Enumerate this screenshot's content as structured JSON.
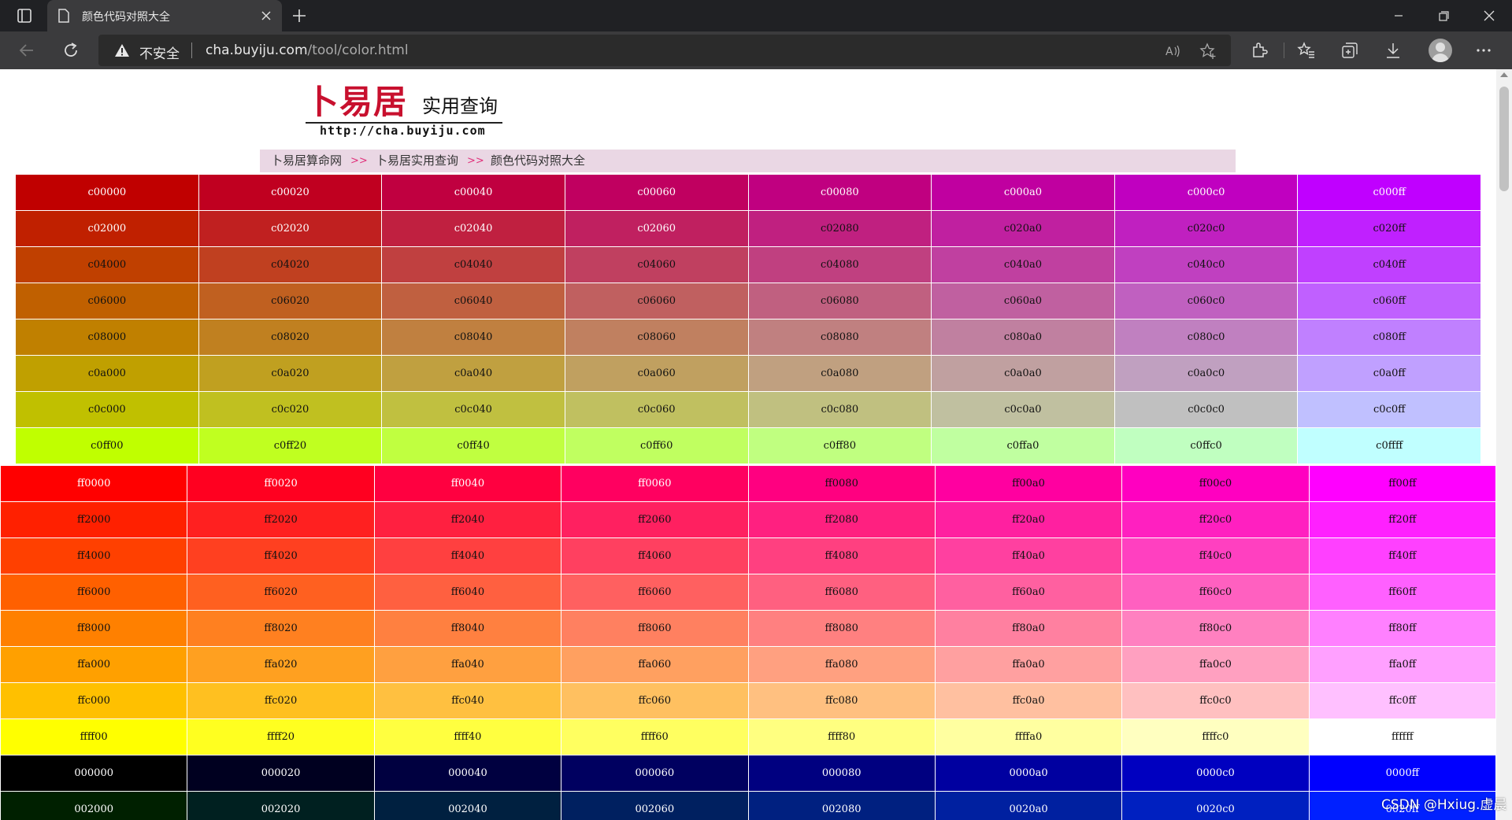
{
  "browser": {
    "tab_title": "颜色代码对照大全",
    "security_label": "不安全",
    "url_host": "cha.buyiju.com",
    "url_path": "/tool/color.html"
  },
  "logo": {
    "brand": "卜易居",
    "subtitle": "实用查询",
    "site": "http://cha.buyiju.com"
  },
  "breadcrumb": {
    "items": [
      "卜易居算命网",
      "卜易居实用查询",
      "颜色代码对照大全"
    ],
    "separator": ">>"
  },
  "table1": {
    "rows": [
      [
        "c00000",
        "c00020",
        "c00040",
        "c00060",
        "c00080",
        "c000a0",
        "c000c0",
        "c000ff"
      ],
      [
        "c02000",
        "c02020",
        "c02040",
        "c02060",
        "c02080",
        "c020a0",
        "c020c0",
        "c020ff"
      ],
      [
        "c04000",
        "c04020",
        "c04040",
        "c04060",
        "c04080",
        "c040a0",
        "c040c0",
        "c040ff"
      ],
      [
        "c06000",
        "c06020",
        "c06040",
        "c06060",
        "c06080",
        "c060a0",
        "c060c0",
        "c060ff"
      ],
      [
        "c08000",
        "c08020",
        "c08040",
        "c08060",
        "c08080",
        "c080a0",
        "c080c0",
        "c080ff"
      ],
      [
        "c0a000",
        "c0a020",
        "c0a040",
        "c0a060",
        "c0a080",
        "c0a0a0",
        "c0a0c0",
        "c0a0ff"
      ],
      [
        "c0c000",
        "c0c020",
        "c0c040",
        "c0c060",
        "c0c080",
        "c0c0a0",
        "c0c0c0",
        "c0c0ff"
      ],
      [
        "c0ff00",
        "c0ff20",
        "c0ff40",
        "c0ff60",
        "c0ff80",
        "c0ffa0",
        "c0ffc0",
        "c0ffff"
      ]
    ]
  },
  "table2": {
    "rows": [
      [
        "ff0000",
        "ff0020",
        "ff0040",
        "ff0060",
        "ff0080",
        "ff00a0",
        "ff00c0",
        "ff00ff"
      ],
      [
        "ff2000",
        "ff2020",
        "ff2040",
        "ff2060",
        "ff2080",
        "ff20a0",
        "ff20c0",
        "ff20ff"
      ],
      [
        "ff4000",
        "ff4020",
        "ff4040",
        "ff4060",
        "ff4080",
        "ff40a0",
        "ff40c0",
        "ff40ff"
      ],
      [
        "ff6000",
        "ff6020",
        "ff6040",
        "ff6060",
        "ff6080",
        "ff60a0",
        "ff60c0",
        "ff60ff"
      ],
      [
        "ff8000",
        "ff8020",
        "ff8040",
        "ff8060",
        "ff8080",
        "ff80a0",
        "ff80c0",
        "ff80ff"
      ],
      [
        "ffa000",
        "ffa020",
        "ffa040",
        "ffa060",
        "ffa080",
        "ffa0a0",
        "ffa0c0",
        "ffa0ff"
      ],
      [
        "ffc000",
        "ffc020",
        "ffc040",
        "ffc060",
        "ffc080",
        "ffc0a0",
        "ffc0c0",
        "ffc0ff"
      ],
      [
        "ffff00",
        "ffff20",
        "ffff40",
        "ffff60",
        "ffff80",
        "ffffa0",
        "ffffc0",
        "ffffff"
      ],
      [
        "000000",
        "000020",
        "000040",
        "000060",
        "000080",
        "0000a0",
        "0000c0",
        "0000ff"
      ],
      [
        "002000",
        "002020",
        "002040",
        "002060",
        "002080",
        "0020a0",
        "0020c0",
        "0020ff"
      ]
    ]
  },
  "watermark": "CSDN @Hxiug.虚晨"
}
